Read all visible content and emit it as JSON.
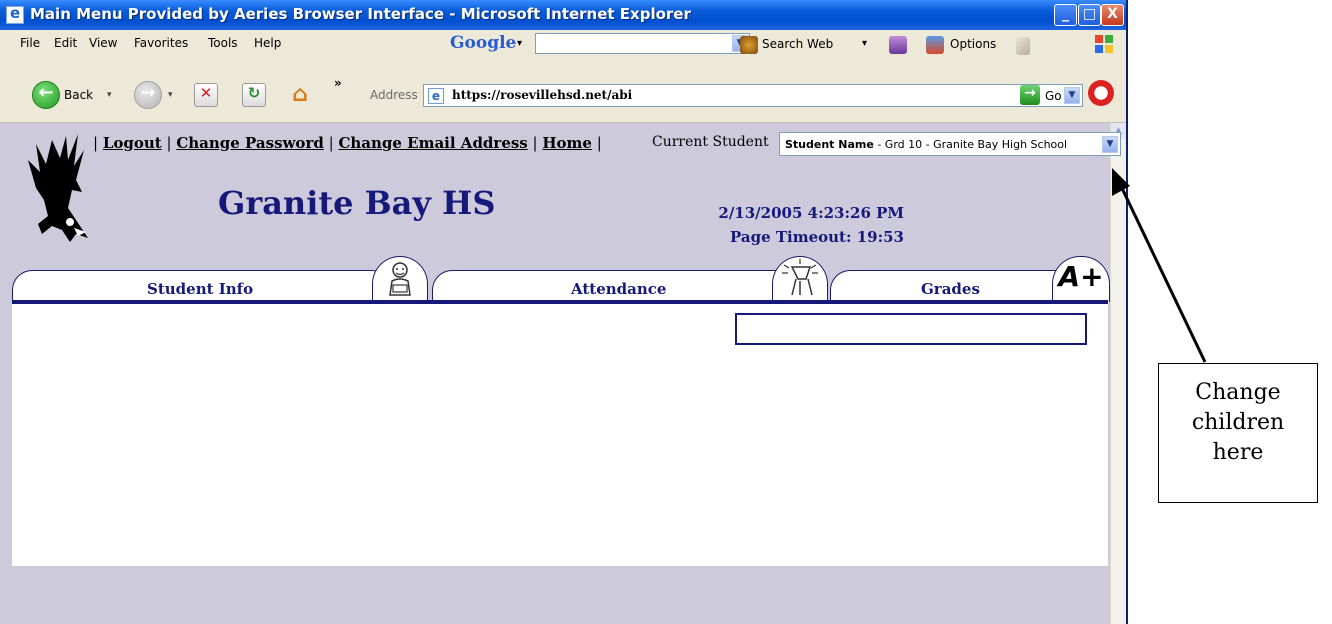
{
  "window": {
    "title": "Main Menu Provided by Aeries Browser Interface - Microsoft Internet Explorer",
    "controls": {
      "minimize": "_",
      "maximize": "□",
      "close": "X"
    }
  },
  "menubar": {
    "items": [
      "File",
      "Edit",
      "View",
      "Favorites",
      "Tools",
      "Help"
    ],
    "google_label": "Google",
    "search_web_label": "Search Web",
    "options_label": "Options"
  },
  "toolbar": {
    "back_label": "Back",
    "chevron": "»",
    "address_label": "Address",
    "address_value": "https://rosevillehsd.net/abi",
    "go_label": "Go"
  },
  "page": {
    "nav_links": [
      "Logout",
      "Change Password",
      "Change Email Address",
      "Home"
    ],
    "current_student_label": "Current Student",
    "student_select": {
      "selected_name": "Student Name",
      "selected_rest": " - Grd 10 - Granite Bay High School"
    },
    "school_name": "Granite Bay HS",
    "datetime": "2/13/2005 4:23:26 PM",
    "page_timeout": "Page Timeout:  19:53",
    "tabs": [
      {
        "label": "Student Info",
        "icon": "student-reading-icon"
      },
      {
        "label": "Attendance",
        "icon": "chair-icon"
      },
      {
        "label": "Grades",
        "icon": "a-plus-icon"
      }
    ],
    "grades_icon_text": "A+"
  },
  "annotation": {
    "line1": "Change",
    "line2": "children",
    "line3": "here"
  },
  "colors": {
    "title_bar": "#0A5DD8",
    "page_bg": "#CCCADB",
    "brand_navy": "#16187A"
  }
}
